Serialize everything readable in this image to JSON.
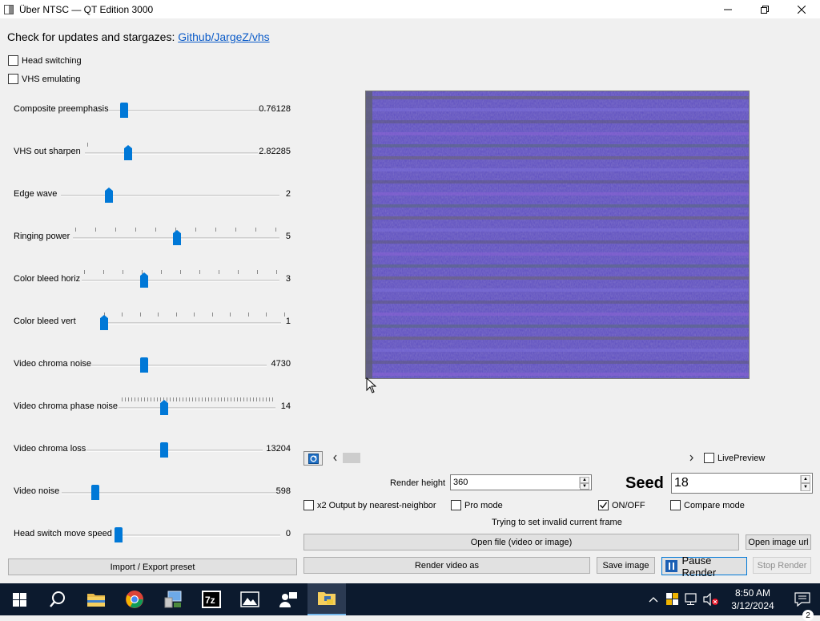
{
  "window": {
    "title": "Über NTSC — QT Edition 3000"
  },
  "header": {
    "prefix": "Check for updates and stargazes: ",
    "link": "Github/JargeZ/vhs"
  },
  "toggles": [
    {
      "label": "Head switching",
      "checked": false
    },
    {
      "label": "VHS emulating",
      "checked": false
    }
  ],
  "sliders": [
    {
      "label": "Composite preemphasis",
      "value": "0.76128"
    },
    {
      "label": "VHS out sharpen",
      "value": "2.82285"
    },
    {
      "label": "Edge wave",
      "value": "2"
    },
    {
      "label": "Ringing power",
      "value": "5"
    },
    {
      "label": "Color bleed horiz",
      "value": "3"
    },
    {
      "label": "Color bleed vert",
      "value": "1"
    },
    {
      "label": "Video chroma noise",
      "value": "4730"
    },
    {
      "label": "Video chroma phase noise",
      "value": "14"
    },
    {
      "label": "Video chroma loss",
      "value": "13204"
    },
    {
      "label": "Video noise",
      "value": "598"
    },
    {
      "label": "Head switch move speed",
      "value": "0"
    }
  ],
  "buttons": {
    "import_export": "Import / Export preset",
    "open_file": "Open file (video or image)",
    "open_url": "Open image url",
    "render_video": "Render video as",
    "save_image": "Save image",
    "pause_render": "Pause Render",
    "stop_render": "Stop Render"
  },
  "preview": {
    "live_preview": "LivePreview",
    "live_checked": false
  },
  "render": {
    "height_label": "Render height",
    "height_value": "360",
    "seed_label": "Seed",
    "seed_value": "18"
  },
  "options": [
    {
      "label": "x2 Output by nearest-neighbor",
      "checked": false
    },
    {
      "label": "Pro mode",
      "checked": false
    },
    {
      "label": "ON/OFF",
      "checked": true
    },
    {
      "label": "Compare mode",
      "checked": false
    }
  ],
  "status": "Trying to set invalid current frame",
  "taskbar": {
    "time": "8:50 AM",
    "date": "3/12/2024",
    "notifications": "2",
    "colors": {
      "bg": "#0c1a2e",
      "accent": "#0078d7"
    }
  }
}
